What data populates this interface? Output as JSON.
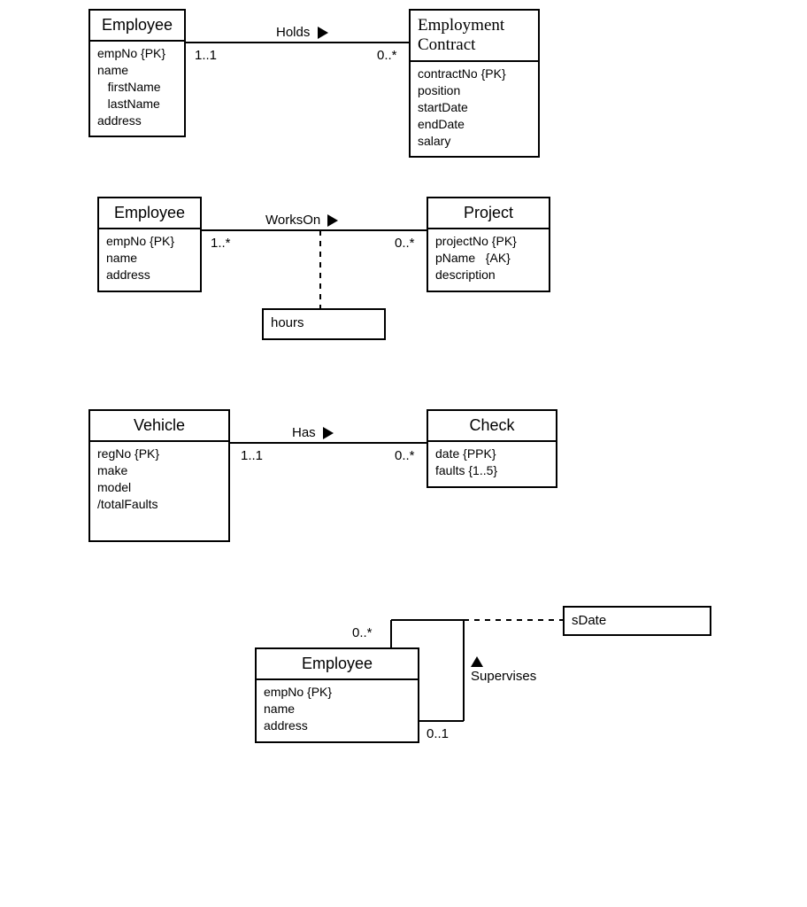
{
  "diagram1": {
    "left": {
      "title": "Employee",
      "attrs": "empNo {PK}\nname\n   firstName\n   lastName\naddress"
    },
    "right": {
      "title": "Employment\nContract",
      "attrs": "contractNo {PK}\nposition\nstartDate\nendDate\nsalary"
    },
    "rel": "Holds",
    "multL": "1..1",
    "multR": "0..*"
  },
  "diagram2": {
    "left": {
      "title": "Employee",
      "attrs": "empNo {PK}\nname\naddress"
    },
    "right": {
      "title": "Project",
      "attrs": "projectNo {PK}\npName   {AK}\ndescription"
    },
    "rel": "WorksOn",
    "multL": "1..*",
    "multR": "0..*",
    "assocAttr": "hours"
  },
  "diagram3": {
    "left": {
      "title": "Vehicle",
      "attrs": "regNo {PK}\nmake\nmodel\n/totalFaults"
    },
    "right": {
      "title": "Check",
      "attrs": "date {PPK}\nfaults {1..5}"
    },
    "rel": "Has",
    "multL": "1..1",
    "multR": "0..*"
  },
  "diagram4": {
    "entity": {
      "title": "Employee",
      "attrs": "empNo {PK}\nname\naddress"
    },
    "rel": "Supervises",
    "multTop": "0..*",
    "multBottom": "0..1",
    "assocAttr": "sDate"
  }
}
